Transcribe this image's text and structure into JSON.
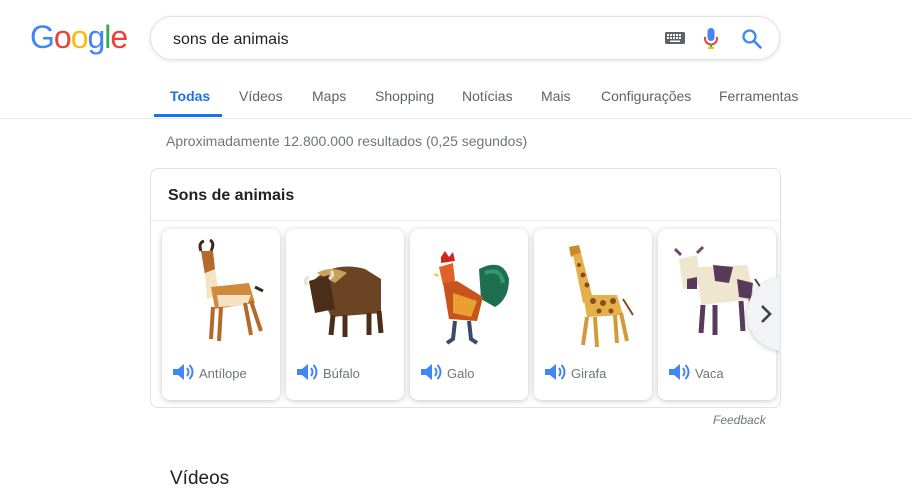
{
  "logo": {
    "letters": [
      "G",
      "o",
      "o",
      "g",
      "l",
      "e"
    ],
    "colors": [
      "#4285F4",
      "#EA4335",
      "#FBBC05",
      "#4285F4",
      "#34A853",
      "#EA4335"
    ]
  },
  "search": {
    "query": "sons de animais"
  },
  "tabs": [
    "Todas",
    "Vídeos",
    "Maps",
    "Shopping",
    "Notícias",
    "Mais",
    "Configurações",
    "Ferramentas"
  ],
  "result_stats": "Aproximadamente 12.800.000 resultados (0,25 segundos)",
  "card": {
    "title": "Sons de animais",
    "animals": [
      "Antílope",
      "Búfalo",
      "Galo",
      "Girafa",
      "Vaca"
    ]
  },
  "feedback": "Feedback",
  "section_heading": "Vídeos",
  "colors": {
    "accent": "#1a73e8",
    "speaker": "#4285f4"
  }
}
